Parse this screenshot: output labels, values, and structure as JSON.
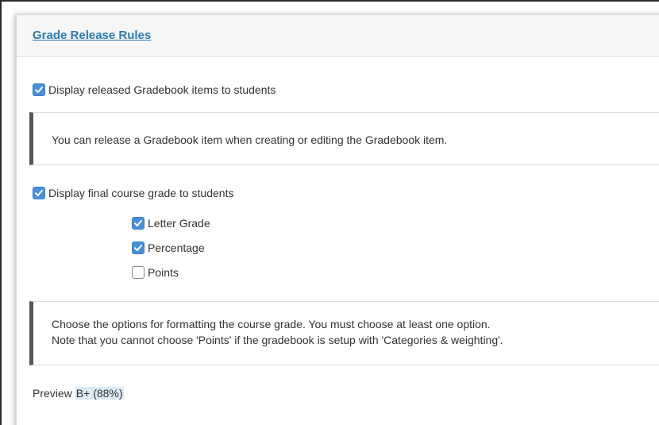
{
  "panel": {
    "title": "Grade Release Rules"
  },
  "release_items": {
    "label": "Display released Gradebook items to students",
    "checked": true
  },
  "release_note": {
    "text": "You can release a Gradebook item when creating or editing the Gradebook item."
  },
  "final_grade": {
    "label": "Display final course grade to students",
    "checked": true,
    "options": [
      {
        "label": "Letter Grade",
        "checked": true
      },
      {
        "label": "Percentage",
        "checked": true
      },
      {
        "label": "Points",
        "checked": false
      }
    ]
  },
  "format_note": {
    "line1": "Choose the options for formatting the course grade. You must choose at least one option.",
    "line2": "Note that you cannot choose 'Points' if the gradebook is setup with 'Categories & weighting'."
  },
  "preview": {
    "label": "Preview",
    "value": "B+ (88%)"
  },
  "colors": {
    "link": "#2a7ab0",
    "checkbox_checked": "#4a90d9",
    "note_bar": "#555555",
    "preview_highlight": "#dbeaf6"
  },
  "icons": {
    "checkmark": "check-icon"
  }
}
